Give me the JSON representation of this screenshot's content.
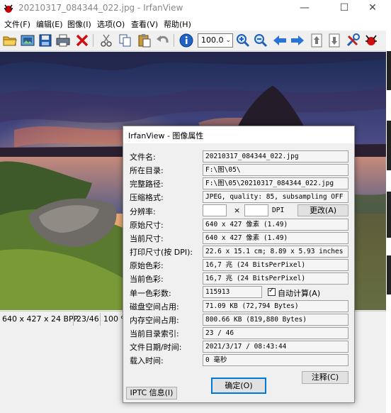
{
  "window": {
    "title": "20210317_084344_022.jpg - IrfanView",
    "minimize": "—",
    "maximize": "☐",
    "close": "✕"
  },
  "menu": [
    "文件(F)",
    "编辑(E)",
    "图像(I)",
    "选项(O)",
    "查看(V)",
    "帮助(H)"
  ],
  "toolbar": {
    "zoom_value": "100.0"
  },
  "status": {
    "dimensions": "640 x 427 x 24 BPP",
    "index": "23/46",
    "zoom": "100 %"
  },
  "dialog": {
    "title": "IrfanView - 图像属性",
    "rows": [
      {
        "label": "文件名:",
        "value": "20210317_084344_022.jpg"
      },
      {
        "label": "所在目录:",
        "value": "F:\\图\\05\\"
      },
      {
        "label": "完整路径:",
        "value": "F:\\图\\05\\20210317_084344_022.jpg"
      },
      {
        "label": "压缩格式:",
        "value": "JPEG, quality: 85, subsampling OFF"
      }
    ],
    "resolution_label": "分辨率:",
    "resolution_x": "",
    "resolution_sep": "×",
    "resolution_y": "",
    "dpi_label": "DPI",
    "change_button": "更改(A)",
    "rows2": [
      {
        "label": "原始尺寸:",
        "value": "640 x 427  像素 (1.49)"
      },
      {
        "label": "当前尺寸:",
        "value": "640 x 427  像素 (1.49)"
      },
      {
        "label": "打印尺寸(按 DPI):",
        "value": "22.6 x 15.1 cm; 8.89 x 5.93 inches"
      },
      {
        "label": "原始色彩:",
        "value": "16,7 兆   (24 BitsPerPixel)"
      },
      {
        "label": "当前色彩:",
        "value": "16,7 兆   (24 BitsPerPixel)"
      }
    ],
    "unique_colors_label": "单一色彩数:",
    "unique_colors_value": "115913",
    "auto_calc_label": "自动计算(A)",
    "rows3": [
      {
        "label": "磁盘空间占用:",
        "value": "71.09 KB (72,794 Bytes)"
      },
      {
        "label": "内存空间占用:",
        "value": "800.66  KB (819,880 Bytes)"
      },
      {
        "label": "当前目录索引:",
        "value": "23  /  46"
      },
      {
        "label": "文件日期/时间:",
        "value": "2021/3/17 / 08:43:44"
      },
      {
        "label": "载入时间:",
        "value": "0 毫秒"
      }
    ],
    "comment_button": "注释(C)",
    "iptc_button": "IPTC 信息(I)",
    "ok_button": "确定(O)"
  }
}
